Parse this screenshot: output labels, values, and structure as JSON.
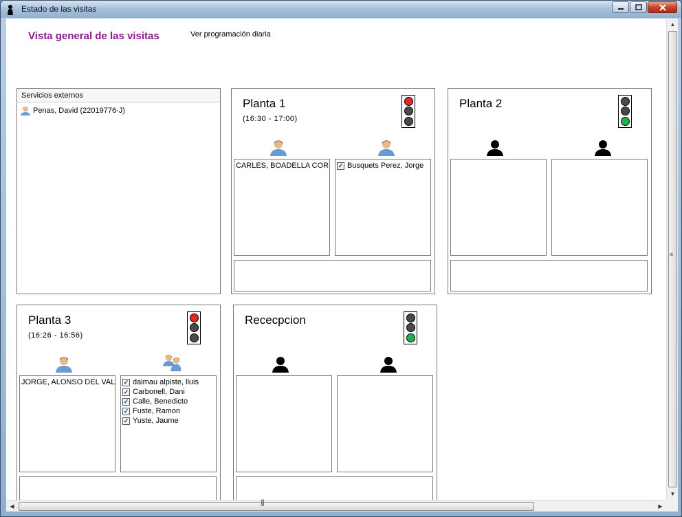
{
  "window": {
    "title": "Estado de las visitas"
  },
  "header": {
    "title": "Vista general de las visitas",
    "link": "Ver programación diaria"
  },
  "external": {
    "header": "Servicios externos",
    "items": [
      "Penas, David (22019776-J)"
    ]
  },
  "rooms": [
    {
      "name": "Planta 1",
      "time": "(16:30 - 17:00)",
      "light": "red",
      "left_list": [
        "CARLES, BOADELLA CORN"
      ],
      "right_list": [
        "Busquets Perez, Jorge"
      ]
    },
    {
      "name": "Planta 2",
      "time": "",
      "light": "green",
      "left_list": [],
      "right_list": []
    },
    {
      "name": "Planta 3",
      "time": "(16:26 - 16:56)",
      "light": "red",
      "left_list": [
        "JORGE, ALONSO DEL VAL"
      ],
      "right_list": [
        "dalmau alpiste, lluis",
        "Carbonell, Dani",
        "Calle, Benedicto",
        "Fuste, Ramon",
        "Yuste, Jaume"
      ]
    },
    {
      "name": "Rececpcion",
      "time": "",
      "light": "green",
      "left_list": [],
      "right_list": []
    }
  ],
  "colors": {
    "title_accent": "#8b1a8b",
    "light_red": "#e8262a",
    "light_green": "#22b14c",
    "light_off": "#4a4a4a"
  },
  "icons": {
    "window": "person-silhouette-icon",
    "present": "person-icon",
    "group": "people-group-icon",
    "empty": "person-silhouette-icon"
  }
}
